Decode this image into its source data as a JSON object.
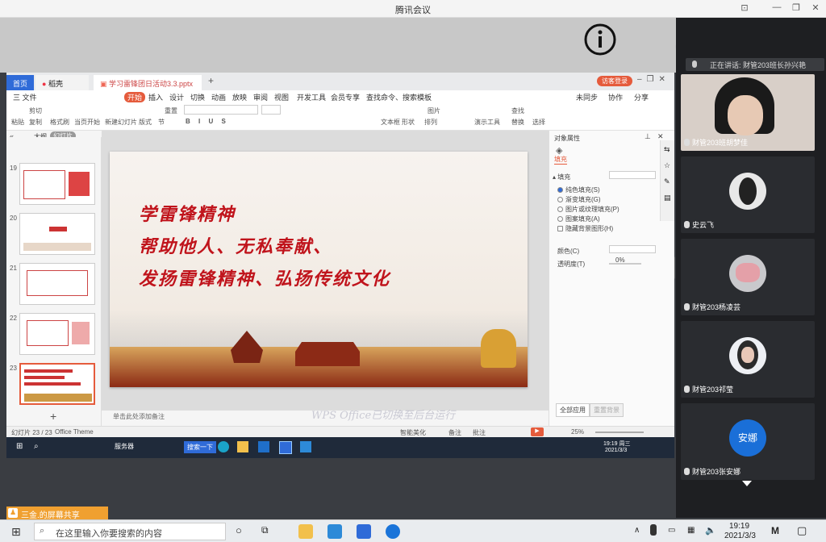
{
  "meeting": {
    "title": "腾讯会议",
    "speaking": "正在讲话: 财管203班长孙兴艳",
    "share_label": "三金.的屏幕共享"
  },
  "participants": [
    {
      "name": "财管203班胡梦佳",
      "avatar_text": ""
    },
    {
      "name": "史云飞",
      "avatar_text": ""
    },
    {
      "name": "财管203杨凌芸",
      "avatar_text": ""
    },
    {
      "name": "财管203祁莹",
      "avatar_text": ""
    },
    {
      "name": "财管203张安娜",
      "avatar_text": "安娜"
    }
  ],
  "wps": {
    "tabs": [
      {
        "label": "首页"
      },
      {
        "label": "稻壳"
      },
      {
        "label": "学习雷锋团日活动3.3.pptx"
      }
    ],
    "login_label": "访客登录",
    "menu": [
      "三 文件",
      "开始",
      "插入",
      "设计",
      "切换",
      "动画",
      "放映",
      "审阅",
      "视图",
      "开发工具",
      "会员专享",
      "查找命令、搜索模板"
    ],
    "menu_right": [
      "未同步",
      "协作",
      "分享"
    ],
    "ribbon": [
      "粘贴",
      "剪切",
      "复制",
      "格式刷",
      "当页开始",
      "新建幻灯片",
      "版式",
      "节",
      "重置",
      "文本框",
      "形状",
      "排列",
      "图片",
      "演示工具",
      "查找",
      "替换",
      "选择"
    ],
    "outline_label": "大纲",
    "slides_label": "幻灯片",
    "thumb_numbers": [
      "19",
      "20",
      "21",
      "22",
      "23"
    ],
    "slide_lines": [
      "学雷锋精神",
      "帮助他人、无私奉献、",
      "发扬雷锋精神、弘扬传统文化"
    ],
    "notes_placeholder": "单击此处添加备注",
    "watermark": "WPS Office已切换至后台运行",
    "props": {
      "title": "对象属性",
      "tab": "填充",
      "section": "填充",
      "options": [
        "纯色填充(S)",
        "渐变填充(G)",
        "图片或纹理填充(P)",
        "图案填充(A)",
        "隐藏背景图形(H)"
      ],
      "color_label": "颜色(C)",
      "transparency_label": "透明度(T)",
      "transparency_value": "0%",
      "apply_all": "全部应用",
      "reset_bg": "重置背景"
    },
    "status": {
      "slide_count": "幻灯片 23 / 23",
      "theme": "Office Theme",
      "smart_beautify": "智能美化",
      "notes": "备注",
      "comments": "批注",
      "zoom": "25%"
    },
    "inner_taskbar": {
      "app_label": "服务器",
      "search_btn": "搜索一下",
      "time": "19:19 周三",
      "date": "2021/3/3"
    }
  },
  "host_taskbar": {
    "search_placeholder": "在这里输入你要搜索的内容",
    "time": "19:19",
    "date": "2021/3/3",
    "ime": "M"
  }
}
